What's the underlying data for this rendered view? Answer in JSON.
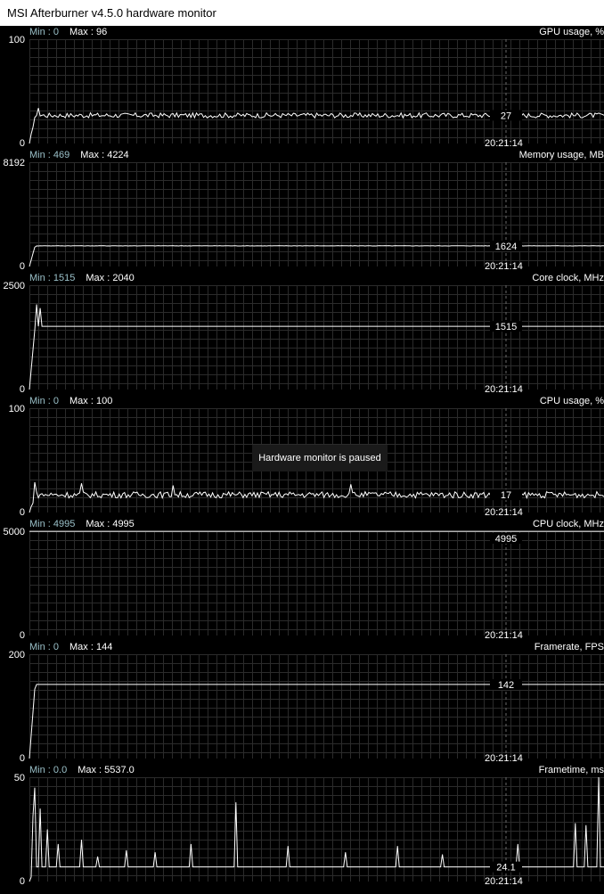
{
  "window": {
    "title": "MSI Afterburner v4.5.0 hardware monitor"
  },
  "overlay": {
    "message": "Hardware monitor is paused"
  },
  "timestamp": "20:21:14",
  "colors": {
    "background": "#000000",
    "grid": "#2b2b2b",
    "trace": "#ffffff",
    "min_label": "#9ac0c8",
    "cursor": "#6a6a6a"
  },
  "graphs": [
    {
      "name": "GPU usage, %",
      "min_text": "Min : 0",
      "max_text": "Max : 96",
      "y_top": "100",
      "y_bottom": "0",
      "ymax": 100,
      "current": "27",
      "base": 27,
      "noise": 1.2,
      "spikes": [
        [
          0.012,
          27
        ],
        [
          0.015,
          34
        ]
      ]
    },
    {
      "name": "Memory usage, MB",
      "min_text": "Min : 469",
      "max_text": "Max : 4224",
      "y_top": "8192",
      "y_bottom": "0",
      "ymax": 8192,
      "current": "1624",
      "base": 1624,
      "noise": 0.1,
      "spikes": []
    },
    {
      "name": "Core clock, MHz",
      "min_text": "Min : 1515",
      "max_text": "Max : 2040",
      "y_top": "2500",
      "y_bottom": "0",
      "ymax": 2500,
      "current": "1515",
      "base": 1515,
      "noise": 0,
      "spikes": [
        [
          0.012,
          2040
        ],
        [
          0.018,
          1950
        ]
      ]
    },
    {
      "name": "CPU usage, %",
      "min_text": "Min : 0",
      "max_text": "Max : 100",
      "y_top": "100",
      "y_bottom": "0",
      "ymax": 100,
      "current": "17",
      "base": 17,
      "noise": 1.5,
      "spikes": [
        [
          0.01,
          31
        ],
        [
          0.09,
          28
        ],
        [
          0.25,
          26
        ],
        [
          0.56,
          27
        ]
      ]
    },
    {
      "name": "CPU clock, MHz",
      "min_text": "Min : 4995",
      "max_text": "Max : 4995",
      "y_top": "5000",
      "y_bottom": "0",
      "ymax": 5000,
      "current": "4995",
      "base": 4995,
      "noise": 0,
      "spikes": []
    },
    {
      "name": "Framerate, FPS",
      "min_text": "Min : 0",
      "max_text": "Max : 144",
      "y_top": "200",
      "y_bottom": "0",
      "ymax": 200,
      "current": "142",
      "base": 142,
      "noise": 0,
      "spikes": []
    },
    {
      "name": "Frametime, ms",
      "min_text": "Min : 0.0",
      "max_text": "Max : 5537.0",
      "y_top": "50",
      "y_bottom": "0",
      "ymax": 50,
      "current": "24.1",
      "base": 7,
      "noise": 0,
      "spikes": [
        [
          0.005,
          50
        ],
        [
          0.01,
          48
        ],
        [
          0.02,
          35
        ],
        [
          0.03,
          25
        ],
        [
          0.05,
          18
        ],
        [
          0.09,
          20
        ],
        [
          0.12,
          12
        ],
        [
          0.17,
          15
        ],
        [
          0.22,
          14
        ],
        [
          0.28,
          18
        ],
        [
          0.36,
          38
        ],
        [
          0.45,
          17
        ],
        [
          0.55,
          14
        ],
        [
          0.64,
          17
        ],
        [
          0.72,
          13
        ],
        [
          0.85,
          18
        ],
        [
          0.95,
          28
        ],
        [
          0.97,
          27
        ],
        [
          0.99,
          50
        ]
      ]
    }
  ]
}
